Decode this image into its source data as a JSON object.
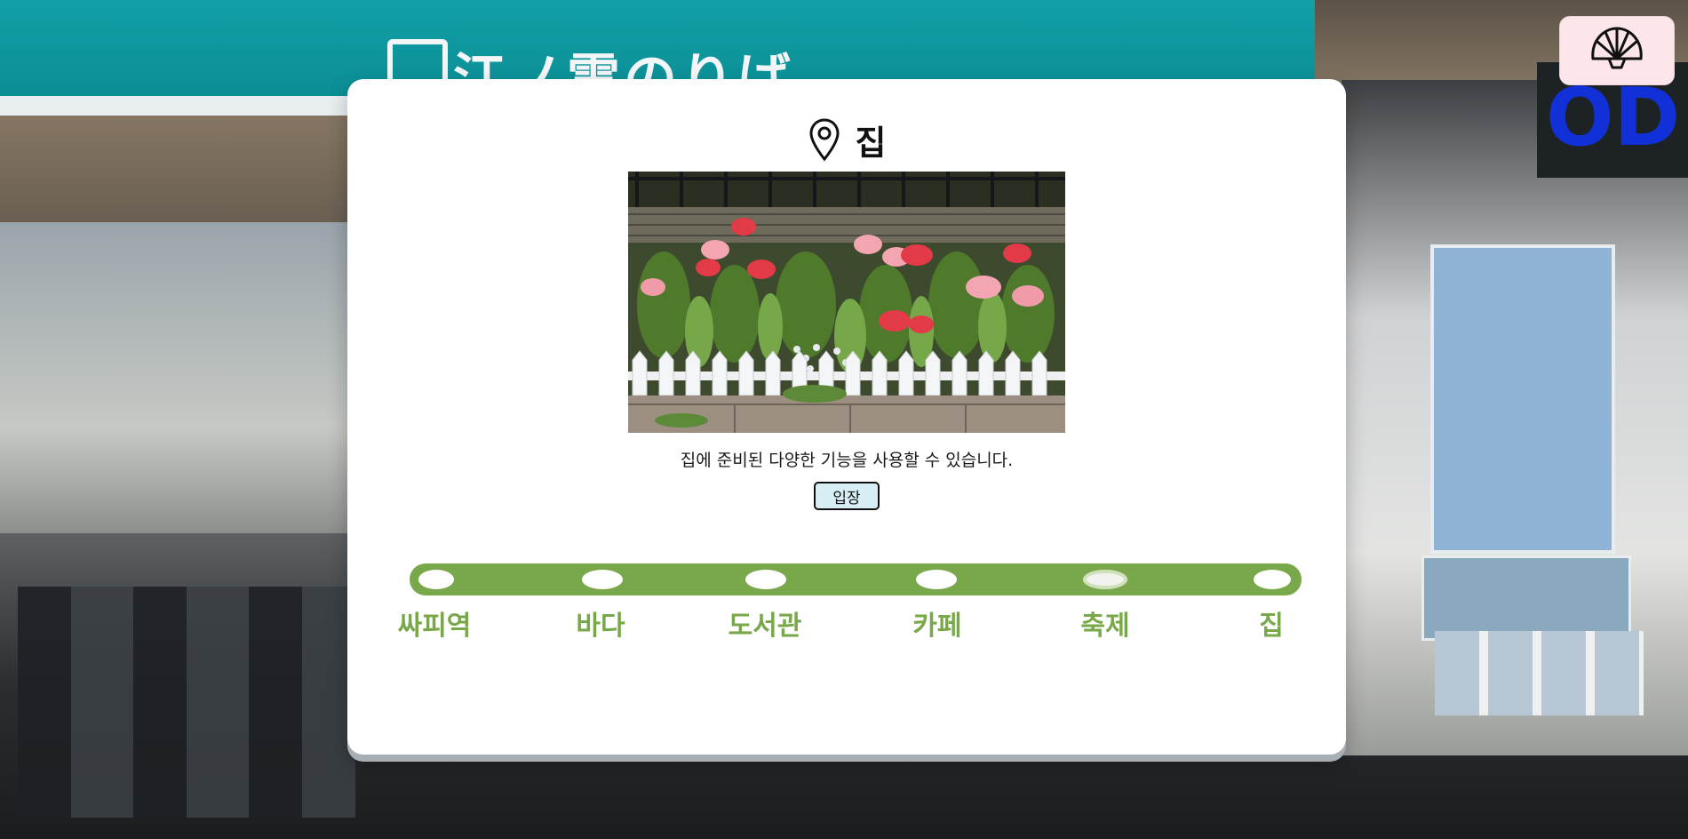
{
  "background": {
    "station_sign_text": "江ノ電のりば",
    "shop_sign_text": "OD"
  },
  "header": {
    "icon": "map-pin-icon",
    "title": "집"
  },
  "photo": {
    "subject": "tulip-garden-photo"
  },
  "description": "집에 준비된 다양한 기능을 사용할 수 있습니다.",
  "enter_button": {
    "label": "입장"
  },
  "route": {
    "color": "#79a84a",
    "stations": [
      {
        "label": "싸피역",
        "active": false
      },
      {
        "label": "바다",
        "active": false
      },
      {
        "label": "도서관",
        "active": false
      },
      {
        "label": "카페",
        "active": false
      },
      {
        "label": "축제",
        "active": true
      },
      {
        "label": "집",
        "active": false
      }
    ]
  },
  "shell_button": {
    "icon": "shell-icon",
    "background": "#fce6ea"
  }
}
